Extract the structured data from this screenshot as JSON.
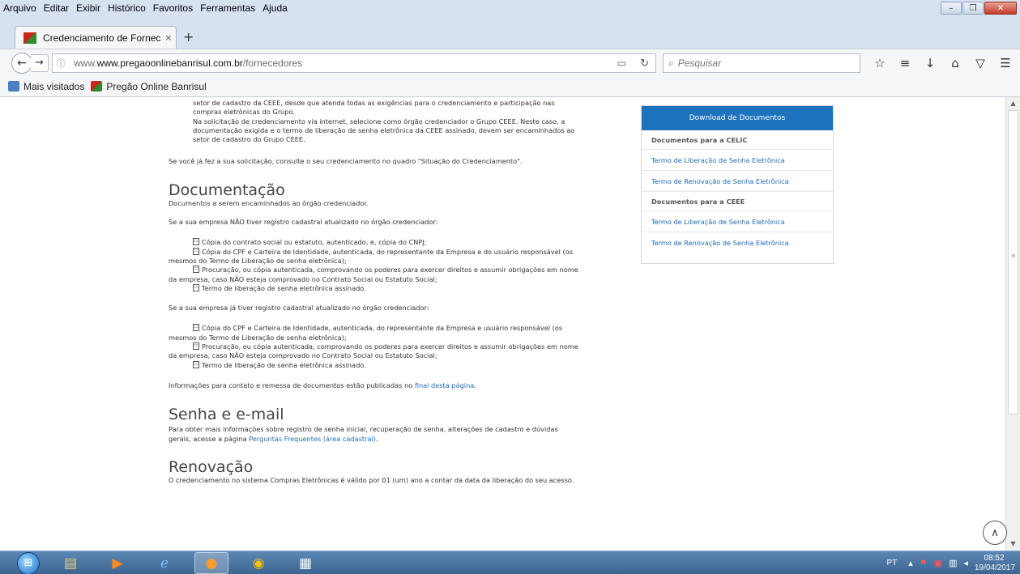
{
  "menu": {
    "items": [
      "Arquivo",
      "Editar",
      "Exibir",
      "Histórico",
      "Favoritos",
      "Ferramentas",
      "Ajuda"
    ]
  },
  "tab": {
    "title": "Credenciamento de Fornec...",
    "close": "×",
    "new": "+"
  },
  "nav": {
    "url_host": "www.pregaoonlinebanrisul.com.br",
    "url_path": "/fornecedores",
    "url_prefix": "www.",
    "search_placeholder": "Pesquisar"
  },
  "bookmarks": {
    "items": [
      "Mais visitados",
      "Pregão Online Banrisul"
    ]
  },
  "main": {
    "intro_lines": [
      "setor de cadastro da CEEE, desde que atenda todas as exigências para o credenciamento e participação nas",
      "compras eletrônicas do Grupo.",
      "Na solicitação de credenciamento via internet, selecione como órgão credenciador o Grupo CEEE. Neste caso, a",
      "documentação exigida e o termo de liberação de senha eletrônica da CEEE assinado, devem ser encaminhados ao",
      "setor de cadastro do Grupo CEEE."
    ],
    "already_requested": "Se você já fez a sua solicitação, consulte o seu credenciamento no quadro \"Situação do Credenciamento\".",
    "doc_title": "Documentação",
    "doc_sub": "Documentos a serem encaminhados ao órgão credenciador.",
    "no_registry": "Se a sua empresa NÃO tiver registro cadastral atualizado no órgão credenciador:",
    "list_a": [
      {
        "icon": true,
        "text": "Cópia do contrato social ou estatuto, autenticado, e, cópia do CNPJ;"
      },
      {
        "icon": true,
        "text": "Cópia do CPF e Carteira de Identidade, autenticada, do representante da Empresa e do usuário responsável (os"
      },
      {
        "icon": false,
        "text": "mesmos do Termo de Liberação de senha eletrônica);"
      },
      {
        "icon": true,
        "text": "Procuração, ou cópia autenticada, comprovando os poderes para exercer direitos e assumir obrigações em nome"
      },
      {
        "icon": false,
        "text": "da empresa, caso NÃO esteja comprovado no Contrato Social ou Estatuto Social;"
      },
      {
        "icon": true,
        "text": "Termo de liberação de senha eletrônica assinado."
      }
    ],
    "has_registry": "Se a sua empresa já tiver registro cadastral atualizado no órgão credenciador:",
    "list_b": [
      {
        "icon": true,
        "text": "Cópia do CPF e Carteira de Identidade, autenticada, do representante da Empresa e usuário responsável (os"
      },
      {
        "icon": false,
        "text": "mesmos do Termo de Liberação de senha eletrônica);"
      },
      {
        "icon": true,
        "text": "Procuração, ou cópia autenticada, comprovando os poderes para exercer direitos e assumir obrigações em nome"
      },
      {
        "icon": false,
        "text": "da empresa, caso NÃO esteja comprovado no Contrato Social ou Estatuto Social;"
      },
      {
        "icon": true,
        "text": "Termo de liberação de senha eletrônica assinado."
      }
    ],
    "contact_pre": "Informações para contato e remessa de documentos estão publicadas no ",
    "contact_link": "final desta página",
    "contact_post": ".",
    "senha_title": "Senha e e-mail",
    "senha_line1": "Para obter mais informações sobre registro de senha inicial, recuperação de senha, alterações de cadastro e dúvidas",
    "senha_line2_pre": "gerais, acesse a página ",
    "senha_link": "Perguntas Frequentes (área cadastral)",
    "senha_line2_post": ".",
    "renov_title": "Renovação",
    "renov_line": "O credenciamento no sistema Compras Eletrônicas é válido por 01 (um) ano a contar da data da liberação do seu acesso."
  },
  "panel": {
    "header": "Download de Documentos",
    "group1": "Documentos para a CELIC",
    "group1_links": [
      "Termo de Liberação de Senha Eletrônica",
      "Termo de Renovação de Senha Eletrônica"
    ],
    "group2": "Documentos para a CEEE",
    "group2_links": [
      "Termo de Liberação de Senha Eletrônica",
      "Termo de Renovação de Senha Eletrônica"
    ]
  },
  "taskbar": {
    "lang": "PT",
    "time": "08:52",
    "date": "19/04/2017"
  },
  "colors": {
    "accent": "#1e73be",
    "link": "#1f6db5",
    "taskbar": "#3d6592"
  }
}
